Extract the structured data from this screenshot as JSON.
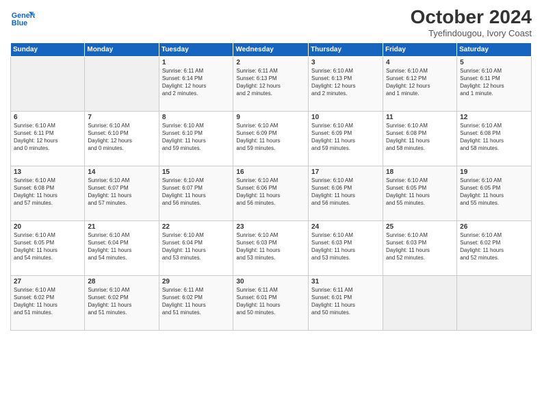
{
  "logo": {
    "line1": "General",
    "line2": "Blue"
  },
  "title": "October 2024",
  "location": "Tyefindougou, Ivory Coast",
  "days_header": [
    "Sunday",
    "Monday",
    "Tuesday",
    "Wednesday",
    "Thursday",
    "Friday",
    "Saturday"
  ],
  "weeks": [
    [
      {
        "day": "",
        "info": ""
      },
      {
        "day": "",
        "info": ""
      },
      {
        "day": "1",
        "info": "Sunrise: 6:11 AM\nSunset: 6:14 PM\nDaylight: 12 hours\nand 2 minutes."
      },
      {
        "day": "2",
        "info": "Sunrise: 6:11 AM\nSunset: 6:13 PM\nDaylight: 12 hours\nand 2 minutes."
      },
      {
        "day": "3",
        "info": "Sunrise: 6:10 AM\nSunset: 6:13 PM\nDaylight: 12 hours\nand 2 minutes."
      },
      {
        "day": "4",
        "info": "Sunrise: 6:10 AM\nSunset: 6:12 PM\nDaylight: 12 hours\nand 1 minute."
      },
      {
        "day": "5",
        "info": "Sunrise: 6:10 AM\nSunset: 6:11 PM\nDaylight: 12 hours\nand 1 minute."
      }
    ],
    [
      {
        "day": "6",
        "info": "Sunrise: 6:10 AM\nSunset: 6:11 PM\nDaylight: 12 hours\nand 0 minutes."
      },
      {
        "day": "7",
        "info": "Sunrise: 6:10 AM\nSunset: 6:10 PM\nDaylight: 12 hours\nand 0 minutes."
      },
      {
        "day": "8",
        "info": "Sunrise: 6:10 AM\nSunset: 6:10 PM\nDaylight: 11 hours\nand 59 minutes."
      },
      {
        "day": "9",
        "info": "Sunrise: 6:10 AM\nSunset: 6:09 PM\nDaylight: 11 hours\nand 59 minutes."
      },
      {
        "day": "10",
        "info": "Sunrise: 6:10 AM\nSunset: 6:09 PM\nDaylight: 11 hours\nand 59 minutes."
      },
      {
        "day": "11",
        "info": "Sunrise: 6:10 AM\nSunset: 6:08 PM\nDaylight: 11 hours\nand 58 minutes."
      },
      {
        "day": "12",
        "info": "Sunrise: 6:10 AM\nSunset: 6:08 PM\nDaylight: 11 hours\nand 58 minutes."
      }
    ],
    [
      {
        "day": "13",
        "info": "Sunrise: 6:10 AM\nSunset: 6:08 PM\nDaylight: 11 hours\nand 57 minutes."
      },
      {
        "day": "14",
        "info": "Sunrise: 6:10 AM\nSunset: 6:07 PM\nDaylight: 11 hours\nand 57 minutes."
      },
      {
        "day": "15",
        "info": "Sunrise: 6:10 AM\nSunset: 6:07 PM\nDaylight: 11 hours\nand 56 minutes."
      },
      {
        "day": "16",
        "info": "Sunrise: 6:10 AM\nSunset: 6:06 PM\nDaylight: 11 hours\nand 56 minutes."
      },
      {
        "day": "17",
        "info": "Sunrise: 6:10 AM\nSunset: 6:06 PM\nDaylight: 11 hours\nand 56 minutes."
      },
      {
        "day": "18",
        "info": "Sunrise: 6:10 AM\nSunset: 6:05 PM\nDaylight: 11 hours\nand 55 minutes."
      },
      {
        "day": "19",
        "info": "Sunrise: 6:10 AM\nSunset: 6:05 PM\nDaylight: 11 hours\nand 55 minutes."
      }
    ],
    [
      {
        "day": "20",
        "info": "Sunrise: 6:10 AM\nSunset: 6:05 PM\nDaylight: 11 hours\nand 54 minutes."
      },
      {
        "day": "21",
        "info": "Sunrise: 6:10 AM\nSunset: 6:04 PM\nDaylight: 11 hours\nand 54 minutes."
      },
      {
        "day": "22",
        "info": "Sunrise: 6:10 AM\nSunset: 6:04 PM\nDaylight: 11 hours\nand 53 minutes."
      },
      {
        "day": "23",
        "info": "Sunrise: 6:10 AM\nSunset: 6:03 PM\nDaylight: 11 hours\nand 53 minutes."
      },
      {
        "day": "24",
        "info": "Sunrise: 6:10 AM\nSunset: 6:03 PM\nDaylight: 11 hours\nand 53 minutes."
      },
      {
        "day": "25",
        "info": "Sunrise: 6:10 AM\nSunset: 6:03 PM\nDaylight: 11 hours\nand 52 minutes."
      },
      {
        "day": "26",
        "info": "Sunrise: 6:10 AM\nSunset: 6:02 PM\nDaylight: 11 hours\nand 52 minutes."
      }
    ],
    [
      {
        "day": "27",
        "info": "Sunrise: 6:10 AM\nSunset: 6:02 PM\nDaylight: 11 hours\nand 51 minutes."
      },
      {
        "day": "28",
        "info": "Sunrise: 6:10 AM\nSunset: 6:02 PM\nDaylight: 11 hours\nand 51 minutes."
      },
      {
        "day": "29",
        "info": "Sunrise: 6:11 AM\nSunset: 6:02 PM\nDaylight: 11 hours\nand 51 minutes."
      },
      {
        "day": "30",
        "info": "Sunrise: 6:11 AM\nSunset: 6:01 PM\nDaylight: 11 hours\nand 50 minutes."
      },
      {
        "day": "31",
        "info": "Sunrise: 6:11 AM\nSunset: 6:01 PM\nDaylight: 11 hours\nand 50 minutes."
      },
      {
        "day": "",
        "info": ""
      },
      {
        "day": "",
        "info": ""
      }
    ]
  ]
}
